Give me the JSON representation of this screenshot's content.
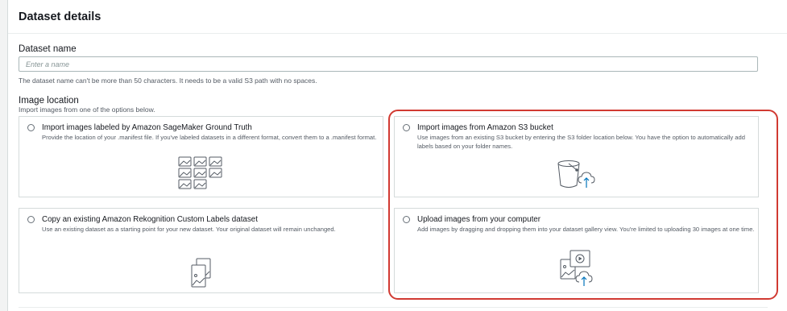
{
  "panel": {
    "title": "Dataset details"
  },
  "dataset_name": {
    "label": "Dataset name",
    "placeholder": "Enter a name",
    "value": "",
    "hint": "The dataset name can't be more than 50 characters. It needs to be a valid S3 path with no spaces."
  },
  "image_location": {
    "label": "Image location",
    "description": "Import images from one of the options below.",
    "options": [
      {
        "title": "Import images labeled by Amazon SageMaker Ground Truth",
        "description": "Provide the location of your .manifest file. If you've labeled datasets in a different format, convert them to a .manifest format.",
        "icon": "image-grid-icon",
        "selected": false
      },
      {
        "title": "Import images from Amazon S3 bucket",
        "description": "Use images from an existing S3 bucket by entering the S3 folder location below. You have the option to automatically add labels based on your folder names.",
        "icon": "s3-bucket-upload-icon",
        "selected": false
      },
      {
        "title": "Copy an existing Amazon Rekognition Custom Labels dataset",
        "description": "Use an existing dataset as a starting point for your new dataset. Your original dataset will remain unchanged.",
        "icon": "copy-images-icon",
        "selected": false
      },
      {
        "title": "Upload images from your computer",
        "description": "Add images by dragging and dropping them into your dataset gallery view. You're limited to uploading 30 images at one time.",
        "icon": "computer-upload-icon",
        "selected": false
      }
    ]
  },
  "colors": {
    "highlight": "#d13a32",
    "border": "#d5dbdb",
    "text": "#16191f",
    "muted": "#545b64",
    "icon_stroke": "#545b64",
    "upload_accent": "#0073bb"
  }
}
